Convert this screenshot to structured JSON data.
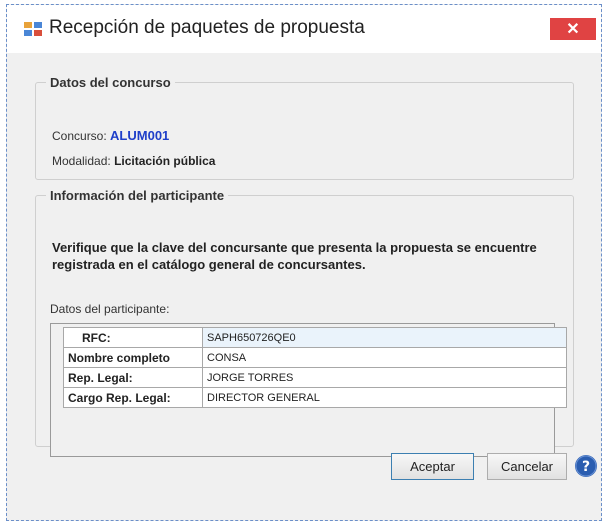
{
  "window": {
    "title": "Recepción de paquetes de propuesta",
    "close_label": "✕"
  },
  "concurso_section": {
    "legend": "Datos del concurso",
    "concurso_label": "Concurso:",
    "concurso_value": "ALUM001",
    "modalidad_label": "Modalidad:",
    "modalidad_value": "Licitación pública"
  },
  "participante_section": {
    "legend": "Información del participante",
    "instruction": "Verifique que la clave del concursante que presenta la propuesta se encuentre registrada en el catálogo general de concursantes.",
    "datos_label": "Datos del participante:",
    "rows": [
      {
        "key": "RFC:",
        "value": "SAPH650726QE0"
      },
      {
        "key": "Nombre completo",
        "value": "CONSA"
      },
      {
        "key": "Rep. Legal:",
        "value": "JORGE TORRES"
      },
      {
        "key": "Cargo Rep. Legal:",
        "value": "DIRECTOR GENERAL"
      }
    ]
  },
  "buttons": {
    "aceptar": "Aceptar",
    "cancelar": "Cancelar"
  },
  "icons": {
    "app": "window-app-icon",
    "help": "help-icon"
  },
  "colors": {
    "close": "#e04343",
    "concurso_value": "#1f3fc9",
    "help": "#2a5db0"
  }
}
